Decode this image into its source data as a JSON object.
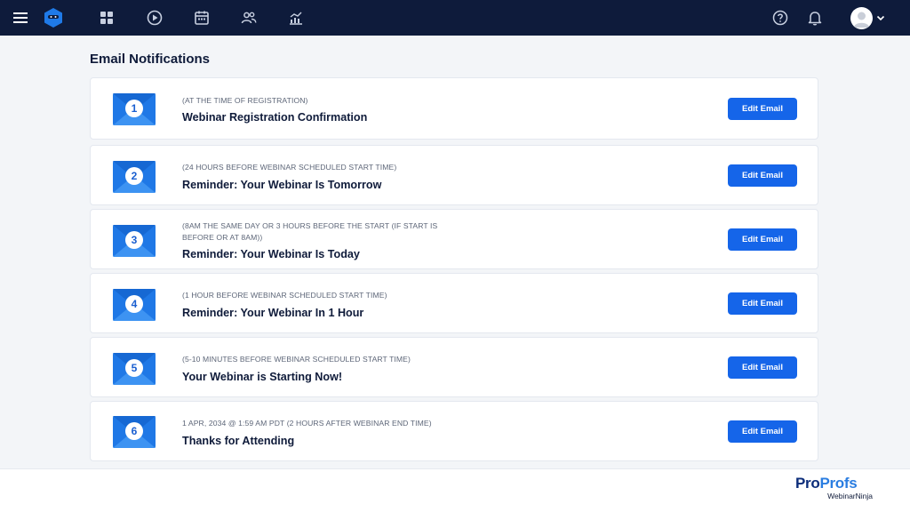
{
  "topbar": {
    "icons": [
      "menu-icon",
      "brand-logo-icon",
      "dashboard-icon",
      "play-icon",
      "calendar-icon",
      "users-icon",
      "analytics-icon",
      "help-icon",
      "bell-icon",
      "avatar",
      "chevron-down-icon"
    ]
  },
  "page": {
    "title": "Email Notifications"
  },
  "emails": [
    {
      "number": "1",
      "timing": "(AT THE TIME OF REGISTRATION)",
      "title": "Webinar Registration Confirmation",
      "button": "Edit Email"
    },
    {
      "number": "2",
      "timing": "(24 HOURS BEFORE WEBINAR SCHEDULED START TIME)",
      "title": "Reminder: Your Webinar Is Tomorrow",
      "button": "Edit Email"
    },
    {
      "number": "3",
      "timing": "(8AM THE SAME DAY OR 3 HOURS BEFORE THE START (IF START IS BEFORE OR AT 8AM))",
      "title": "Reminder: Your Webinar Is Today",
      "button": "Edit Email"
    },
    {
      "number": "4",
      "timing": "(1 HOUR BEFORE WEBINAR SCHEDULED START TIME)",
      "title": "Reminder: Your Webinar In 1 Hour",
      "button": "Edit Email"
    },
    {
      "number": "5",
      "timing": "(5-10 MINUTES BEFORE WEBINAR SCHEDULED START TIME)",
      "title": "Your Webinar is Starting Now!",
      "button": "Edit Email"
    },
    {
      "number": "6",
      "timing": "1 APR, 2034 @ 1:59 AM PDT (2 HOURS AFTER WEBINAR END TIME)",
      "title": "Thanks for Attending",
      "button": "Edit Email"
    }
  ],
  "footer": {
    "logo_part1": "Pro",
    "logo_part2": "Profs",
    "logo_sub": "WebinarNinja"
  },
  "colors": {
    "topbar": "#0e1b3b",
    "accent": "#1565e9",
    "background": "#f3f5f8"
  }
}
